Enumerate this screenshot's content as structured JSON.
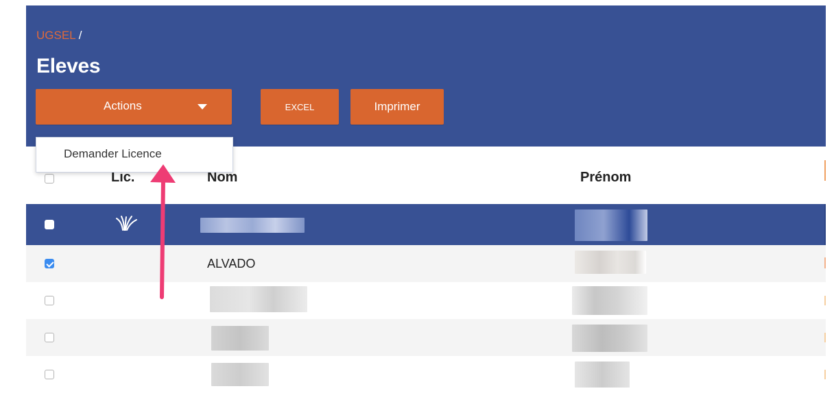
{
  "breadcrumb": {
    "link": "UGSEL",
    "separator": " /"
  },
  "page_title": "Eleves",
  "toolbar": {
    "actions_label": "Actions",
    "excel_label": "EXCEL",
    "print_label": "Imprimer"
  },
  "dropdown": {
    "items": [
      {
        "label": "Demander Licence"
      }
    ]
  },
  "table": {
    "columns": [
      "Lic.",
      "Nom",
      "Prénom"
    ],
    "rows": [
      {
        "checked": false,
        "selected": true,
        "has_licence_icon": true,
        "nom": "",
        "prenom": ""
      },
      {
        "checked": true,
        "selected": false,
        "has_licence_icon": false,
        "nom": "ALVADO",
        "prenom": ""
      },
      {
        "checked": false,
        "selected": false,
        "has_licence_icon": false,
        "nom": "",
        "prenom": ""
      },
      {
        "checked": false,
        "selected": false,
        "has_licence_icon": false,
        "nom": "",
        "prenom": ""
      },
      {
        "checked": false,
        "selected": false,
        "has_licence_icon": false,
        "nom": "",
        "prenom": ""
      }
    ]
  },
  "colors": {
    "header_bg": "#385194",
    "accent_orange": "#d9662f",
    "breadcrumb_link": "#e0693a",
    "checkbox_checked": "#3b8cf0",
    "annotation_arrow": "#ee3c74"
  },
  "icons": {
    "dropdown_caret": "chevron-down-icon",
    "licence": "licence-leaf-icon",
    "annotation": "annotation-arrow-icon"
  }
}
